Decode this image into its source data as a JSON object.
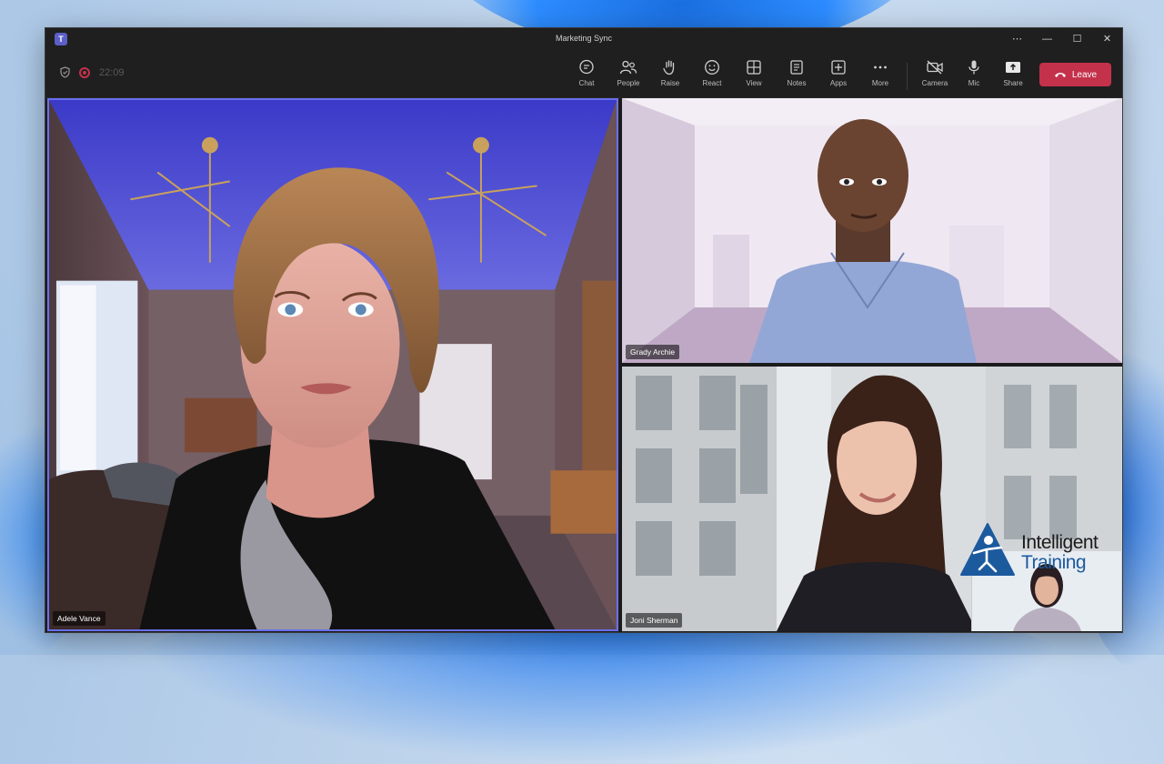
{
  "window": {
    "title": "Marketing Sync",
    "controls": [
      "⋯",
      "—",
      "☐",
      "✕"
    ]
  },
  "toolbar": {
    "timer": "22:09",
    "buttons": [
      {
        "label": "Chat",
        "icon": "chat-icon"
      },
      {
        "label": "People",
        "icon": "people-icon"
      },
      {
        "label": "Raise",
        "icon": "raise-hand-icon"
      },
      {
        "label": "React",
        "icon": "react-icon"
      },
      {
        "label": "View",
        "icon": "view-icon"
      },
      {
        "label": "Notes",
        "icon": "notes-icon"
      },
      {
        "label": "Apps",
        "icon": "apps-icon"
      },
      {
        "label": "More",
        "icon": "more-icon"
      },
      {
        "label": "Camera",
        "icon": "camera-off-icon"
      },
      {
        "label": "Mic",
        "icon": "mic-icon"
      },
      {
        "label": "Share",
        "icon": "share-icon"
      }
    ],
    "leave_label": "Leave"
  },
  "participants": [
    {
      "name": "Adele Vance"
    },
    {
      "name": "Grady Archie"
    },
    {
      "name": "Joni Sherman"
    }
  ],
  "watermark": {
    "line1": "Intelligent",
    "line2": "Training"
  },
  "colors": {
    "accent": "#6a6ff0",
    "leave": "#c4314b",
    "toolbar": "#1f1f1f"
  }
}
